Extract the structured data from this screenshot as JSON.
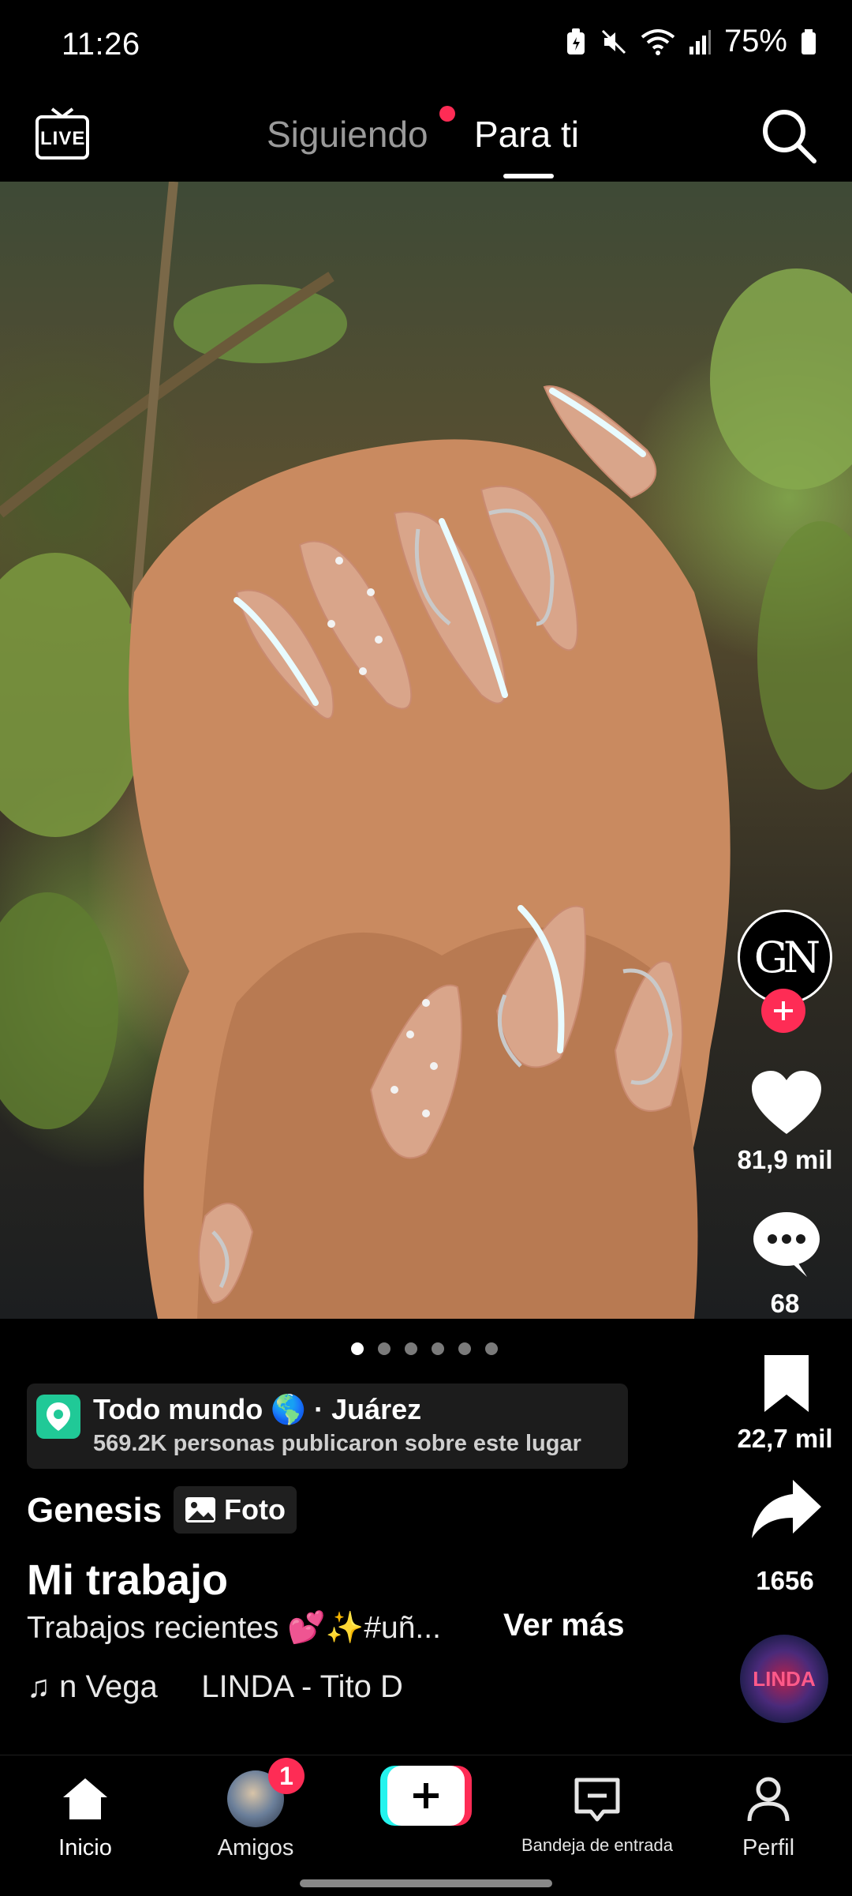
{
  "status_bar": {
    "time": "11:26",
    "battery": "75%"
  },
  "top_nav": {
    "live_label": "LIVE",
    "tab_following": "Siguiendo",
    "tab_for_you": "Para ti"
  },
  "right_rail": {
    "avatar_text": "GN",
    "likes": "81,9 mil",
    "comments": "68",
    "saves": "22,7 mil",
    "shares": "1656",
    "music_disc_text": "LINDA"
  },
  "carousel": {
    "count": 6,
    "active_index": 0
  },
  "location": {
    "title": "Todo mundo 🌎 · Juárez",
    "subtitle": "569.2K personas publicaron sobre este lugar"
  },
  "post": {
    "author": "Genesis",
    "type_label": "Foto",
    "title": "Mi trabajo",
    "description": "Trabajos recientes 💕✨#uñ...",
    "see_more": "Ver más",
    "music": "♫ n Vega     LINDA - Tito D"
  },
  "bottom_nav": {
    "home": "Inicio",
    "friends": "Amigos",
    "friends_badge": "1",
    "create": "+",
    "inbox": "Bandeja de entrada",
    "profile": "Perfil"
  },
  "colors": {
    "accent": "#fe2c55",
    "location_icon": "#20c997",
    "create_left": "#25f4ee"
  }
}
